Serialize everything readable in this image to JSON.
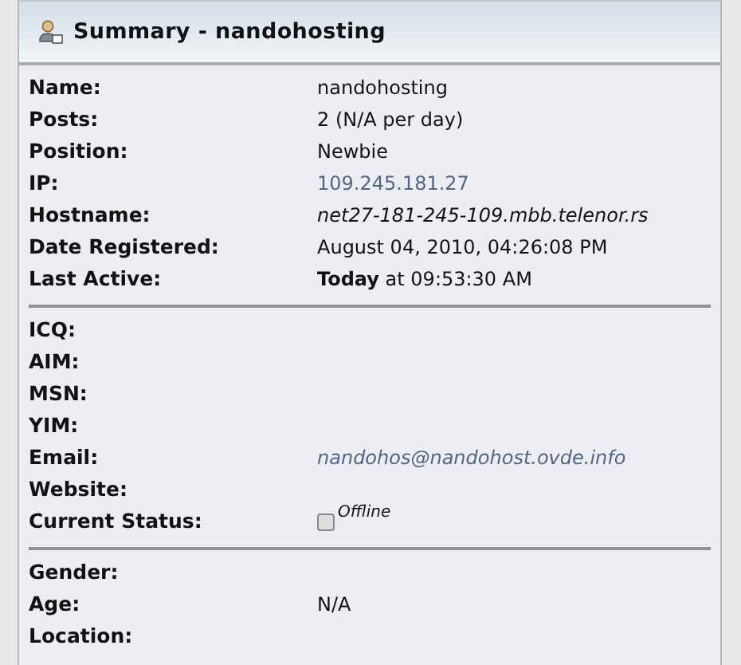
{
  "panel": {
    "title": "Summary - nandohosting"
  },
  "sections": [
    {
      "rows": [
        {
          "label": "Name:",
          "value": "nandohosting",
          "kind": "text"
        },
        {
          "label": "Posts:",
          "value": "2 (N/A per day)",
          "kind": "text"
        },
        {
          "label": "Position:",
          "value": "Newbie",
          "kind": "text"
        },
        {
          "label": "IP:",
          "value": "109.245.181.27",
          "kind": "link"
        },
        {
          "label": "Hostname:",
          "value": "net27-181-245-109.mbb.telenor.rs",
          "kind": "italic"
        },
        {
          "label": "Date Registered:",
          "value": "August 04, 2010, 04:26:08 PM",
          "kind": "text"
        },
        {
          "label": "Last Active:",
          "value": "**Today** at 09:53:30 AM",
          "kind": "text"
        }
      ]
    },
    {
      "rows": [
        {
          "label": "ICQ:"
        },
        {
          "label": "AIM:"
        },
        {
          "label": "MSN:"
        },
        {
          "label": "YIM:"
        },
        {
          "label": "Email:",
          "value": "nandohos@nandohost.ovde.info",
          "kind": "email"
        },
        {
          "label": "Website:"
        },
        {
          "label": "Current Status:",
          "value": "Offline",
          "kind": "status",
          "online": false
        }
      ]
    },
    {
      "rows": [
        {
          "label": "Gender:"
        },
        {
          "label": "Age:",
          "value": "N/A",
          "kind": "text"
        },
        {
          "label": "Location:"
        }
      ]
    }
  ]
}
